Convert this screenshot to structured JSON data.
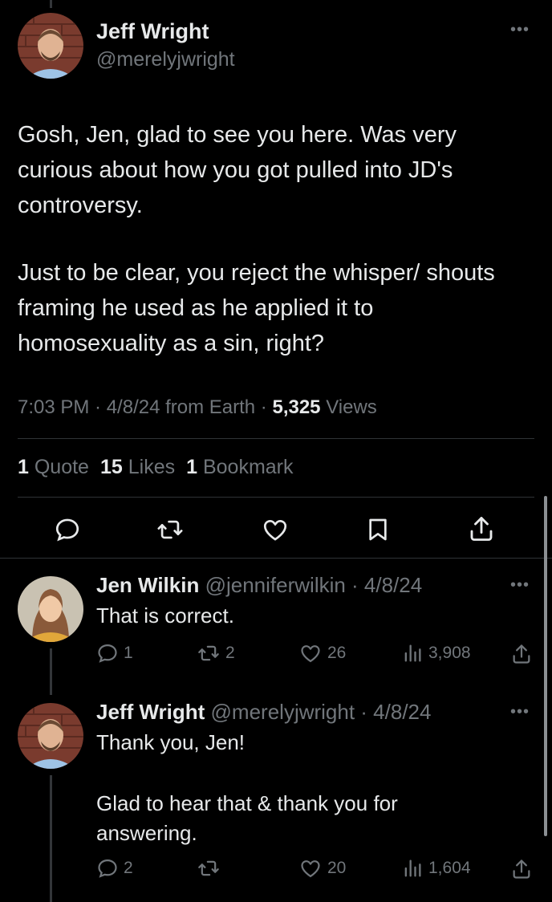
{
  "main_tweet": {
    "author_name": "Jeff Wright",
    "handle": "@merelyjwright",
    "text_p1": "Gosh, Jen, glad to see you here. Was very curious about how you got pulled into JD's controversy.",
    "text_p2": "Just to be clear, you reject the whisper/ shouts framing he used as he applied it to homosexuality as a sin, right?",
    "meta_time": "7:03 PM · 4/8/24 from Earth · ",
    "views_count": "5,325",
    "views_label": " Views",
    "stats": [
      {
        "count": "1",
        "label": "Quote"
      },
      {
        "count": "15",
        "label": "Likes"
      },
      {
        "count": "1",
        "label": "Bookmark"
      }
    ]
  },
  "replies": [
    {
      "author_name": "Jen Wilkin",
      "handle_date": "@jenniferwilkin · 4/8/24",
      "text": "That is correct.",
      "replies": "1",
      "reposts": "2",
      "likes": "26",
      "views": "3,908"
    },
    {
      "author_name": "Jeff Wright",
      "handle_date": "@merelyjwright · 4/8/24",
      "text_p1": "Thank you, Jen!",
      "text_p2": "Glad to hear that & thank you for answering.",
      "replies": "2",
      "reposts": "",
      "likes": "20",
      "views": "1,604"
    }
  ],
  "colors": {
    "background": "#000000",
    "text": "#e7e9ea",
    "secondary": "#71767b",
    "divider": "#2f3336"
  },
  "icons": [
    "more-icon",
    "reply-icon",
    "repost-icon",
    "like-icon",
    "bookmark-icon",
    "share-icon",
    "views-icon"
  ]
}
